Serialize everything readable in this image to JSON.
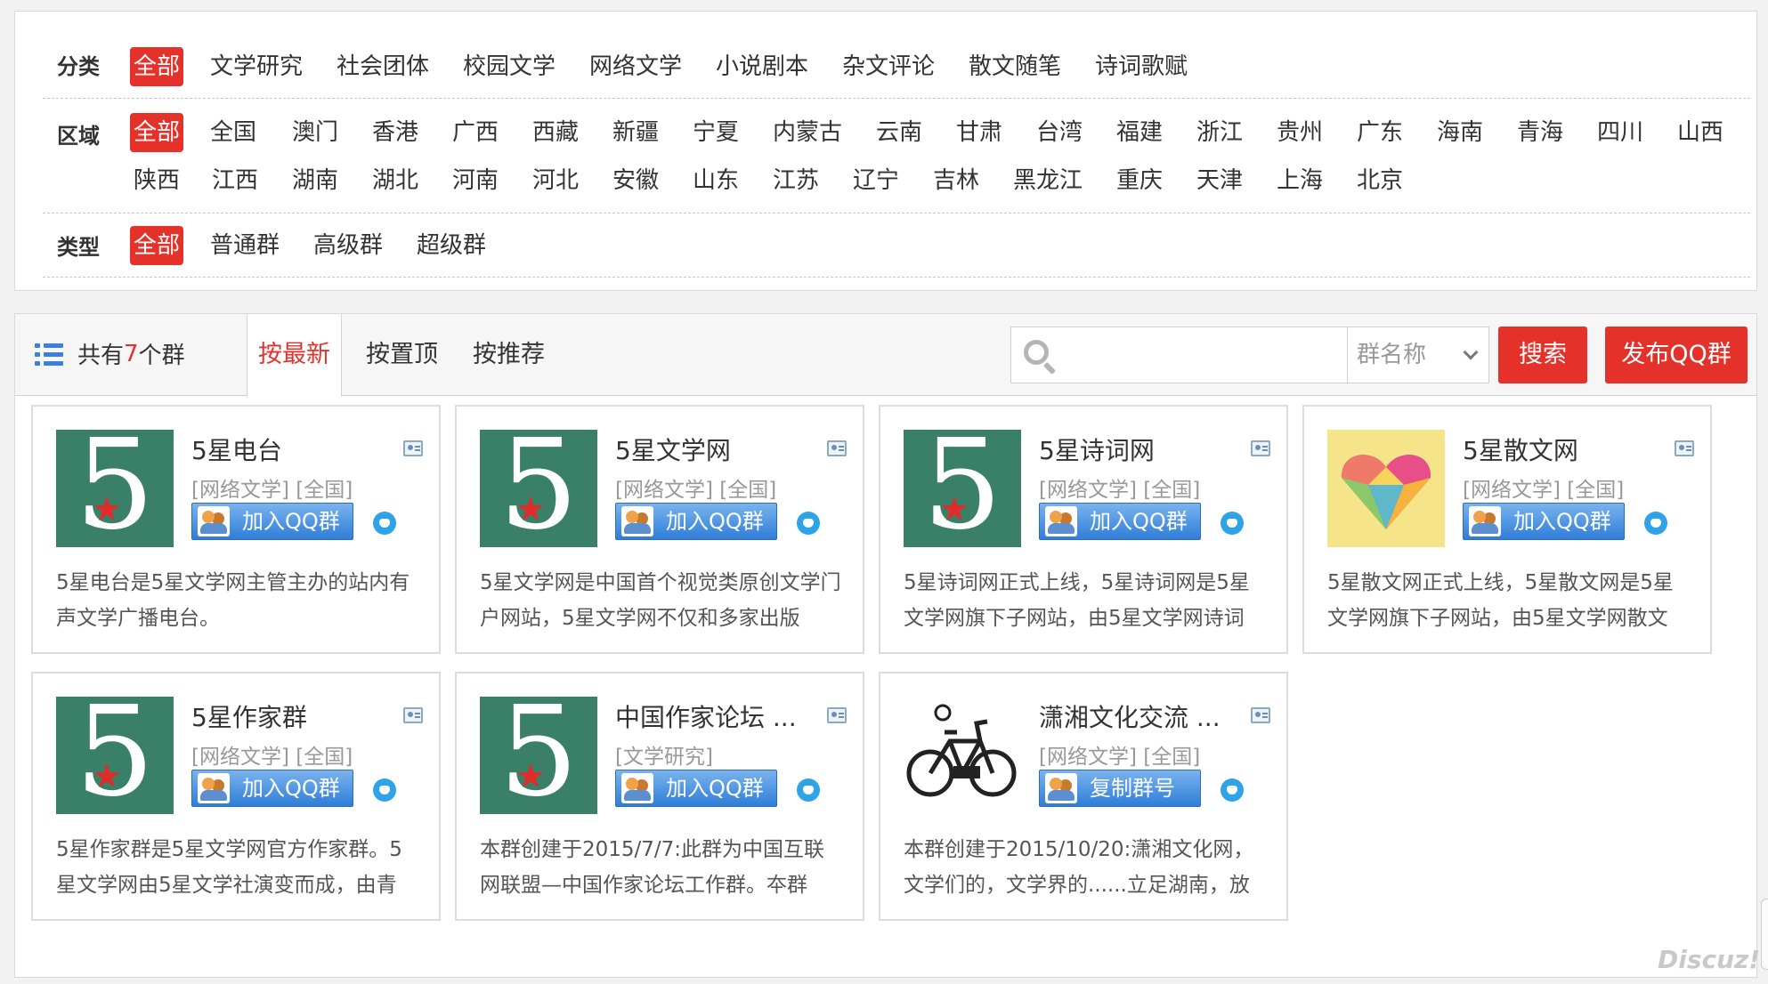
{
  "filters": {
    "category": {
      "label": "分类",
      "options": [
        "全部",
        "文学研究",
        "社会团体",
        "校园文学",
        "网络文学",
        "小说剧本",
        "杂文评论",
        "散文随笔",
        "诗词歌赋"
      ]
    },
    "region": {
      "label": "区域",
      "row1": [
        "全部",
        "全国",
        "澳门",
        "香港",
        "广西",
        "西藏",
        "新疆",
        "宁夏",
        "内蒙古",
        "云南",
        "甘肃",
        "台湾",
        "福建",
        "浙江",
        "贵州",
        "广东",
        "海南",
        "青海",
        "四川",
        "山西"
      ],
      "row2": [
        "陕西",
        "江西",
        "湖南",
        "湖北",
        "河南",
        "河北",
        "安徽",
        "山东",
        "江苏",
        "辽宁",
        "吉林",
        "黑龙江",
        "重庆",
        "天津",
        "上海",
        "北京"
      ]
    },
    "type": {
      "label": "类型",
      "options": [
        "全部",
        "普通群",
        "高级群",
        "超级群"
      ]
    }
  },
  "toolbar": {
    "count_prefix": "共有",
    "count_num": "7",
    "count_suffix": "个群",
    "tabs": [
      "按最新",
      "按置顶",
      "按推荐"
    ],
    "search_placeholder": "",
    "select_value": "群名称",
    "search_button": "搜索",
    "publish_button": "发布QQ群"
  },
  "cards": [
    {
      "title": "5星电台",
      "meta": "[网络文学] [全国]",
      "button": "加入QQ群",
      "desc": "5星电台是5星文学网主管主办的站内有声文学广播电台。",
      "logo": "five"
    },
    {
      "title": "5星文学网",
      "meta": "[网络文学] [全国]",
      "button": "加入QQ群",
      "desc": "5星文学网是中国首个视觉类原创文学门户网站，5星文学网不仅和多家出版",
      "logo": "five"
    },
    {
      "title": "5星诗词网",
      "meta": "[网络文学] [全国]",
      "button": "加入QQ群",
      "desc": "5星诗词网正式上线，5星诗词网是5星文学网旗下子网站，由5星文学网诗词",
      "logo": "five"
    },
    {
      "title": "5星散文网",
      "meta": "[网络文学] [全国]",
      "button": "加入QQ群",
      "desc": "5星散文网正式上线，5星散文网是5星文学网旗下子网站，由5星文学网散文",
      "logo": "heart"
    },
    {
      "title": "5星作家群",
      "meta": "[网络文学] [全国]",
      "button": "加入QQ群",
      "desc": "5星作家群是5星文学网官方作家群。5星文学网由5星文学社演变而成，由青",
      "logo": "five"
    },
    {
      "title": "中国作家论坛 ...",
      "meta": "[文学研究]",
      "button": "加入QQ群",
      "desc": "本群创建于2015/7/7:此群为中国互联网联盟—中国作家论坛工作群。夲群",
      "logo": "five"
    },
    {
      "title": "潇湘文化交流 ...",
      "meta": "[网络文学] [全国]",
      "button": "复制群号",
      "desc": "本群创建于2015/10/20:潇湘文化网，文学们的，文学界的......立足湖南，放",
      "logo": "bike"
    }
  ],
  "watermark": "Discuz!",
  "colors": {
    "accent": "#e4322b",
    "logo_green": "#3a8068",
    "join_blue": "#2f7ed8"
  }
}
